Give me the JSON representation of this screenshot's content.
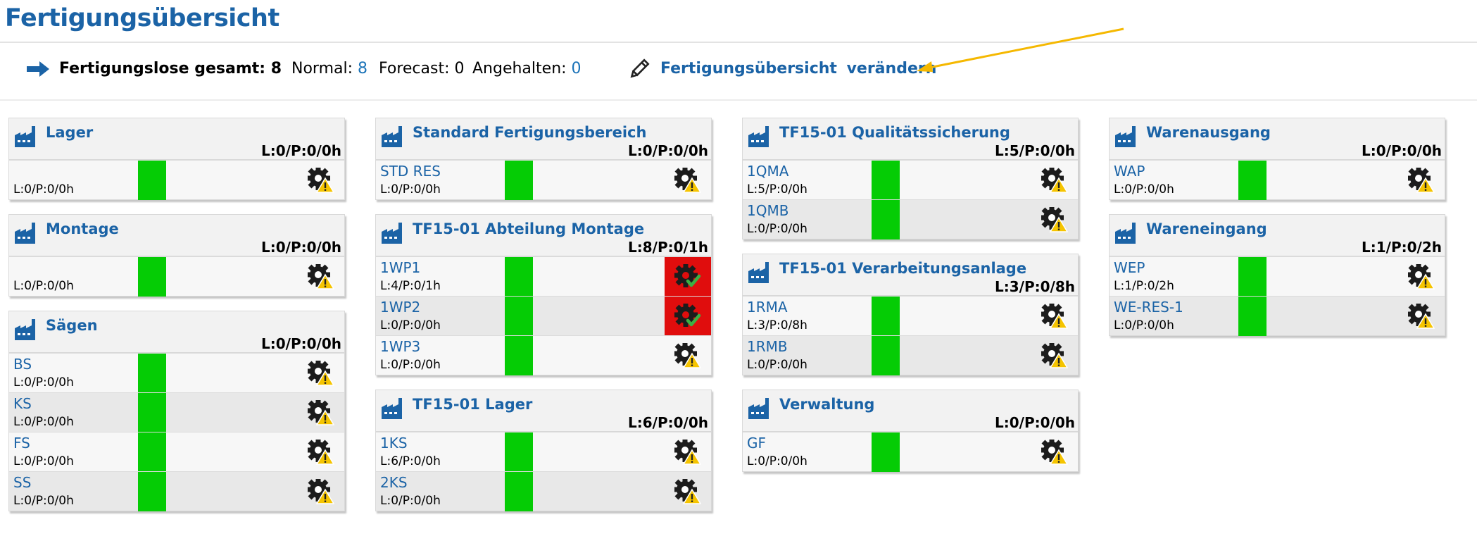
{
  "page": {
    "title": "Fertigungsübersicht"
  },
  "summary": {
    "total_label": "Fertigungslose gesamt: 8",
    "normal_label": "Normal:",
    "normal_value": "8",
    "forecast_label": "Forecast: 0",
    "halted_label": "Angehalten:",
    "halted_value": "0",
    "edit_label": "Fertigungsübersicht verändern"
  },
  "colors": {
    "accent": "#1b63a6",
    "status_ok": "#05cc05",
    "status_alert": "#e00d0d",
    "warning": "#f5c400",
    "annotation_arrow": "#f5b800"
  },
  "groups": [
    {
      "name": "Lager",
      "stats": "L:0/P:0/0h",
      "rows": [
        {
          "name": "",
          "stats": "L:0/P:0/0h",
          "status": "warning"
        }
      ]
    },
    {
      "name": "Montage",
      "stats": "L:0/P:0/0h",
      "rows": [
        {
          "name": "",
          "stats": "L:0/P:0/0h",
          "status": "warning"
        }
      ]
    },
    {
      "name": "Sägen",
      "stats": "L:0/P:0/0h",
      "rows": [
        {
          "name": "BS",
          "stats": "L:0/P:0/0h",
          "status": "warning"
        },
        {
          "name": "KS",
          "stats": "L:0/P:0/0h",
          "status": "warning"
        },
        {
          "name": "FS",
          "stats": "L:0/P:0/0h",
          "status": "warning"
        },
        {
          "name": "SS",
          "stats": "L:0/P:0/0h",
          "status": "warning"
        }
      ]
    },
    {
      "name": "Standard Fertigungsbereich",
      "stats": "L:0/P:0/0h",
      "rows": [
        {
          "name": "STD RES",
          "stats": "L:0/P:0/0h",
          "status": "warning"
        }
      ]
    },
    {
      "name": "TF15-01 Abteilung Montage",
      "stats": "L:8/P:0/1h",
      "rows": [
        {
          "name": "1WP1",
          "stats": "L:4/P:0/1h",
          "status": "ok"
        },
        {
          "name": "1WP2",
          "stats": "L:0/P:0/0h",
          "status": "ok"
        },
        {
          "name": "1WP3",
          "stats": "L:0/P:0/0h",
          "status": "warning"
        }
      ]
    },
    {
      "name": "TF15-01 Lager",
      "stats": "L:6/P:0/0h",
      "rows": [
        {
          "name": "1KS",
          "stats": "L:6/P:0/0h",
          "status": "warning"
        },
        {
          "name": "2KS",
          "stats": "L:0/P:0/0h",
          "status": "warning"
        }
      ]
    },
    {
      "name": "TF15-01 Qualitätssicherung",
      "stats": "L:5/P:0/0h",
      "rows": [
        {
          "name": "1QMA",
          "stats": "L:5/P:0/0h",
          "status": "warning"
        },
        {
          "name": "1QMB",
          "stats": "L:0/P:0/0h",
          "status": "warning"
        }
      ]
    },
    {
      "name": "TF15-01 Verarbeitungsanlage",
      "stats": "L:3/P:0/8h",
      "rows": [
        {
          "name": "1RMA",
          "stats": "L:3/P:0/8h",
          "status": "warning"
        },
        {
          "name": "1RMB",
          "stats": "L:0/P:0/0h",
          "status": "warning"
        }
      ]
    },
    {
      "name": "Verwaltung",
      "stats": "L:0/P:0/0h",
      "rows": [
        {
          "name": "GF",
          "stats": "L:0/P:0/0h",
          "status": "warning"
        }
      ]
    },
    {
      "name": "Warenausgang",
      "stats": "L:0/P:0/0h",
      "rows": [
        {
          "name": "WAP",
          "stats": "L:0/P:0/0h",
          "status": "warning"
        }
      ]
    },
    {
      "name": "Wareneingang",
      "stats": "L:1/P:0/2h",
      "rows": [
        {
          "name": "WEP",
          "stats": "L:1/P:0/2h",
          "status": "warning"
        },
        {
          "name": "WE-RES-1",
          "stats": "L:0/P:0/0h",
          "status": "warning"
        }
      ]
    }
  ]
}
